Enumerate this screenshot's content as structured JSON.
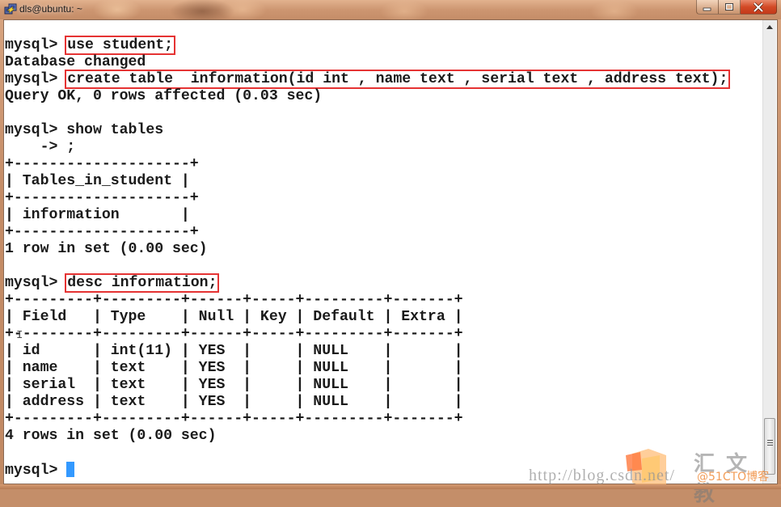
{
  "window": {
    "title": "dls@ubuntu: ~",
    "icon": "putty-icon",
    "controls": {
      "minimize": "minimize-icon",
      "maximize": "maximize-icon",
      "close": "close-icon"
    }
  },
  "terminal": {
    "prompt": "mysql> ",
    "lines": [
      {
        "type": "command",
        "prompt": "mysql> ",
        "text": "use student;",
        "highlighted": true
      },
      {
        "type": "output",
        "text": "Database changed"
      },
      {
        "type": "command",
        "prompt": "mysql> ",
        "text": "create table  information(id int , name text , serial text , address text);",
        "highlighted": true
      },
      {
        "type": "output",
        "text": "Query OK, 0 rows affected (0.03 sec)"
      },
      {
        "type": "blank",
        "text": ""
      },
      {
        "type": "command",
        "prompt": "mysql> ",
        "text": "show tables",
        "highlighted": false
      },
      {
        "type": "output",
        "text": "    -> ;"
      },
      {
        "type": "output",
        "text": "+--------------------+"
      },
      {
        "type": "output",
        "text": "| Tables_in_student |"
      },
      {
        "type": "output",
        "text": "+--------------------+"
      },
      {
        "type": "output",
        "text": "| information       |"
      },
      {
        "type": "output",
        "text": "+--------------------+"
      },
      {
        "type": "output",
        "text": "1 row in set (0.00 sec)"
      },
      {
        "type": "blank",
        "text": ""
      },
      {
        "type": "command",
        "prompt": "mysql> ",
        "text": "desc information;",
        "highlighted": true
      },
      {
        "type": "output",
        "text": "+---------+---------+------+-----+---------+-------+"
      },
      {
        "type": "output",
        "text": "| Field   | Type    | Null | Key | Default | Extra |"
      },
      {
        "type": "output",
        "text": "+---------+---------+------+-----+---------+-------+"
      },
      {
        "type": "output",
        "text": "| id      | int(11) | YES  |     | NULL    |       |"
      },
      {
        "type": "output",
        "text": "| name    | text    | YES  |     | NULL    |       |"
      },
      {
        "type": "output",
        "text": "| serial  | text    | YES  |     | NULL    |       |"
      },
      {
        "type": "output",
        "text": "| address | text    | YES  |     | NULL    |       |"
      },
      {
        "type": "output",
        "text": "+---------+---------+------+-----+---------+-------+"
      },
      {
        "type": "output",
        "text": "4 rows in set (0.00 sec)"
      },
      {
        "type": "blank",
        "text": ""
      },
      {
        "type": "prompt",
        "prompt": "mysql> ",
        "text": ""
      }
    ],
    "show_tables_result": {
      "columns": [
        "Tables_in_student"
      ],
      "rows": [
        [
          "information"
        ]
      ],
      "summary": "1 row in set (0.00 sec)"
    },
    "desc_result": {
      "columns": [
        "Field",
        "Type",
        "Null",
        "Key",
        "Default",
        "Extra"
      ],
      "rows": [
        [
          "id",
          "int(11)",
          "YES",
          "",
          "NULL",
          ""
        ],
        [
          "name",
          "text",
          "YES",
          "",
          "NULL",
          ""
        ],
        [
          "serial",
          "text",
          "YES",
          "",
          "NULL",
          ""
        ],
        [
          "address",
          "text",
          "YES",
          "",
          "NULL",
          ""
        ]
      ],
      "summary": "4 rows in set (0.00 sec)"
    },
    "colors": {
      "highlight_box": "#e53333",
      "cursor": "#3399ff",
      "text": "#1a1a1a",
      "background": "#ffffff"
    }
  },
  "watermark": {
    "url": "http://blog.csdn.net/",
    "brand": "汇文教",
    "sub": "@51CTO博客"
  }
}
